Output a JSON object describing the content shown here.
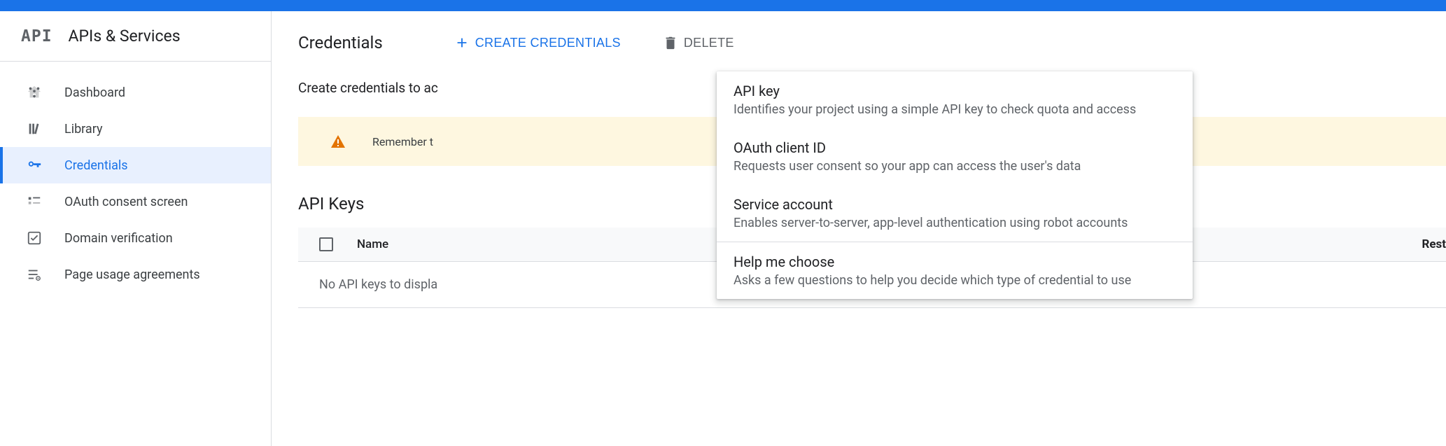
{
  "sidebar": {
    "logo": "API",
    "title": "APIs & Services",
    "items": [
      {
        "label": "Dashboard",
        "icon": "dashboard"
      },
      {
        "label": "Library",
        "icon": "library"
      },
      {
        "label": "Credentials",
        "icon": "key"
      },
      {
        "label": "OAuth consent screen",
        "icon": "consent"
      },
      {
        "label": "Domain verification",
        "icon": "check"
      },
      {
        "label": "Page usage agreements",
        "icon": "settings"
      }
    ]
  },
  "header": {
    "title": "Credentials",
    "create_label": "CREATE CREDENTIALS",
    "delete_label": "DELETE"
  },
  "body": {
    "intro": "Create credentials to ac",
    "alert_text": "Remember t",
    "section_title": "API Keys",
    "table": {
      "col_name": "Name",
      "col_right": "Rest",
      "empty": "No API keys to displa"
    }
  },
  "dropdown": {
    "items": [
      {
        "title": "API key",
        "desc": "Identifies your project using a simple API key to check quota and access"
      },
      {
        "title": "OAuth client ID",
        "desc": "Requests user consent so your app can access the user's data"
      },
      {
        "title": "Service account",
        "desc": "Enables server-to-server, app-level authentication using robot accounts"
      },
      {
        "title": "Help me choose",
        "desc": "Asks a few questions to help you decide which type of credential to use"
      }
    ]
  }
}
